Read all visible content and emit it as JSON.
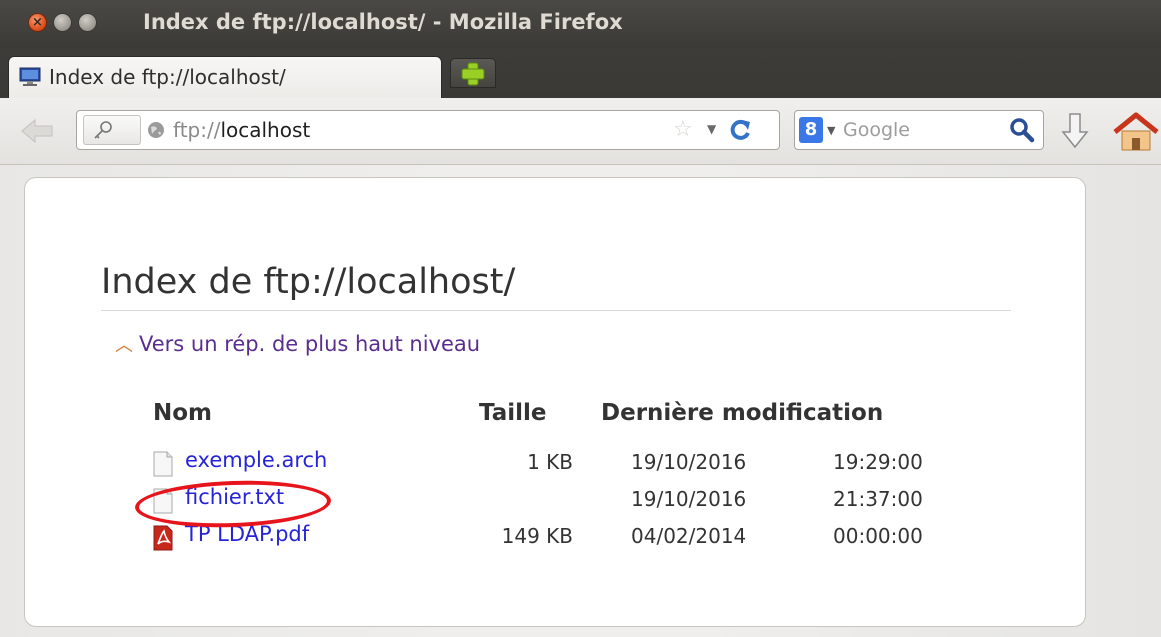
{
  "window": {
    "title": "Index de ftp://localhost/ - Mozilla Firefox"
  },
  "tabs": [
    {
      "label": "Index de ftp://localhost/",
      "active": true
    }
  ],
  "navbar": {
    "url_scheme": "ftp://",
    "url_host": "localhost",
    "search_engine_placeholder": "Google"
  },
  "page": {
    "title": "Index de ftp://localhost/",
    "up_link": "Vers un rép. de plus haut niveau",
    "columns": {
      "name": "Nom",
      "size": "Taille",
      "modified": "Dernière modification"
    },
    "files": [
      {
        "name": "exemple.arch",
        "size": "1 KB",
        "date": "19/10/2016",
        "time": "19:29:00",
        "icon": "file-icon"
      },
      {
        "name": "fichier.txt",
        "size": "",
        "date": "19/10/2016",
        "time": "21:37:00",
        "icon": "file-icon"
      },
      {
        "name": "TP LDAP.pdf",
        "size": "149 KB",
        "date": "04/02/2014",
        "time": "00:00:00",
        "icon": "pdf-icon"
      }
    ]
  },
  "colors": {
    "link": "#2624d8",
    "visited_link": "#5a2e8f",
    "annotation_circle": "#e8141c"
  }
}
